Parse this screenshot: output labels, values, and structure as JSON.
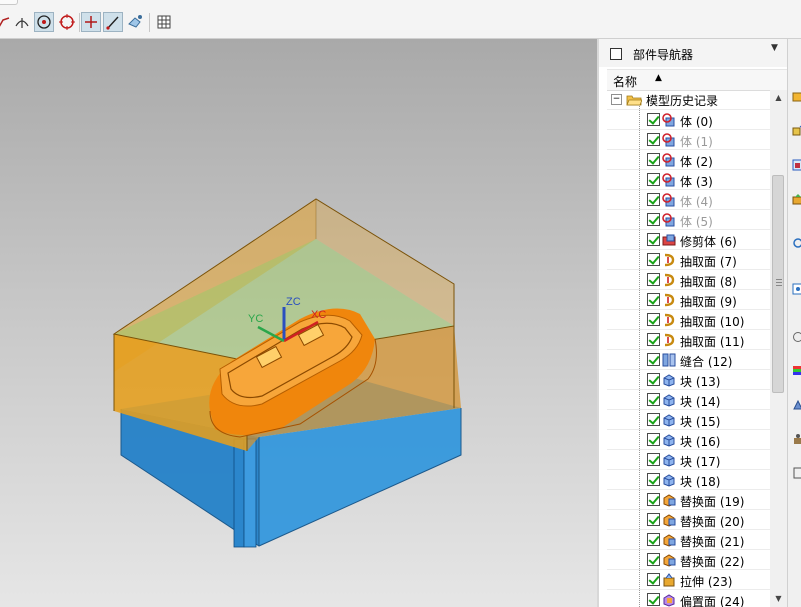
{
  "toolbar": {
    "tools": [
      "curve-icon",
      "angle-icon",
      "point-icon",
      "circle-center-icon",
      "crosshair-icon",
      "line-icon",
      "paint-icon",
      "grid-table-icon"
    ]
  },
  "viewport": {
    "axes": {
      "x": "XC",
      "y": "YC",
      "z": "ZC"
    }
  },
  "navigator": {
    "title": "部件导航器",
    "column_name": "名称",
    "root": "模型历史记录",
    "items": [
      {
        "label": "体 (0)",
        "icon": "body-icon",
        "dim": false
      },
      {
        "label": "体 (1)",
        "icon": "body-icon",
        "dim": true
      },
      {
        "label": "体 (2)",
        "icon": "body-icon",
        "dim": false
      },
      {
        "label": "体 (3)",
        "icon": "body-icon",
        "dim": false
      },
      {
        "label": "体 (4)",
        "icon": "body-icon",
        "dim": true
      },
      {
        "label": "体 (5)",
        "icon": "body-icon",
        "dim": true
      },
      {
        "label": "修剪体 (6)",
        "icon": "trim-body-icon",
        "dim": false
      },
      {
        "label": "抽取面 (7)",
        "icon": "extract-face-icon",
        "dim": false
      },
      {
        "label": "抽取面 (8)",
        "icon": "extract-face-icon",
        "dim": false
      },
      {
        "label": "抽取面 (9)",
        "icon": "extract-face-icon",
        "dim": false
      },
      {
        "label": "抽取面 (10)",
        "icon": "extract-face-icon",
        "dim": false
      },
      {
        "label": "抽取面 (11)",
        "icon": "extract-face-icon",
        "dim": false
      },
      {
        "label": "缝合 (12)",
        "icon": "sew-icon",
        "dim": false
      },
      {
        "label": "块 (13)",
        "icon": "block-icon",
        "dim": false
      },
      {
        "label": "块 (14)",
        "icon": "block-icon",
        "dim": false
      },
      {
        "label": "块 (15)",
        "icon": "block-icon",
        "dim": false
      },
      {
        "label": "块 (16)",
        "icon": "block-icon",
        "dim": false
      },
      {
        "label": "块 (17)",
        "icon": "block-icon",
        "dim": false
      },
      {
        "label": "块 (18)",
        "icon": "block-icon",
        "dim": false
      },
      {
        "label": "替换面 (19)",
        "icon": "replace-face-icon",
        "dim": false
      },
      {
        "label": "替换面 (20)",
        "icon": "replace-face-icon",
        "dim": false
      },
      {
        "label": "替换面 (21)",
        "icon": "replace-face-icon",
        "dim": false
      },
      {
        "label": "替换面 (22)",
        "icon": "replace-face-icon",
        "dim": false
      },
      {
        "label": "拉伸 (23)",
        "icon": "extrude-icon",
        "dim": false
      },
      {
        "label": "偏置面 (24)",
        "icon": "offset-face-icon",
        "dim": false
      }
    ]
  },
  "colors": {
    "cavity": "#e8a92a",
    "core": "#2a8fd6",
    "part": "#f08a10",
    "check": "#17a317"
  }
}
